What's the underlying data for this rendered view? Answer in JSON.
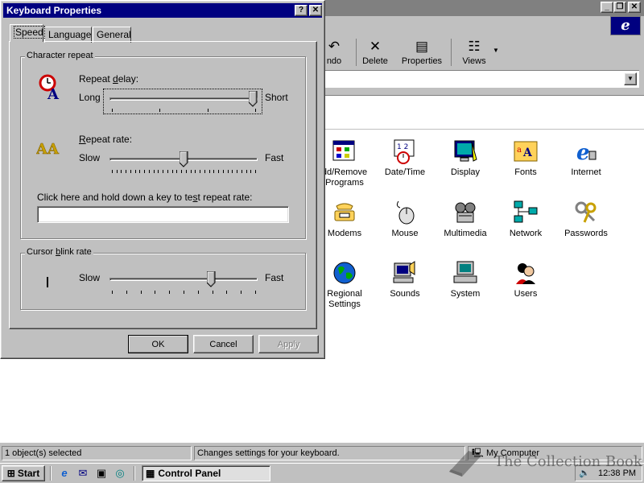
{
  "window": {
    "toolbar": {
      "buttons": [
        {
          "label": "ndo",
          "icon": "undo-icon"
        },
        {
          "label": "Delete",
          "icon": "delete-icon"
        },
        {
          "label": "Properties",
          "icon": "properties-icon"
        },
        {
          "label": "Views",
          "icon": "views-icon"
        }
      ]
    },
    "items": [
      {
        "label": "dd/Remove\nPrograms",
        "icon": "add-remove-programs-icon"
      },
      {
        "label": "Date/Time",
        "icon": "date-time-icon"
      },
      {
        "label": "Display",
        "icon": "display-icon"
      },
      {
        "label": "Fonts",
        "icon": "fonts-icon"
      },
      {
        "label": "Internet",
        "icon": "internet-icon"
      },
      {
        "label": "Modems",
        "icon": "modems-icon"
      },
      {
        "label": "Mouse",
        "icon": "mouse-icon"
      },
      {
        "label": "Multimedia",
        "icon": "multimedia-icon"
      },
      {
        "label": "Network",
        "icon": "network-icon"
      },
      {
        "label": "Passwords",
        "icon": "passwords-icon"
      },
      {
        "label": "Regional\nSettings",
        "icon": "regional-settings-icon"
      },
      {
        "label": "Sounds",
        "icon": "sounds-icon"
      },
      {
        "label": "System",
        "icon": "system-icon"
      },
      {
        "label": "Users",
        "icon": "users-icon"
      }
    ],
    "statusbar": {
      "selection": "1 object(s) selected",
      "description": "Changes settings for your keyboard.",
      "location": "My Computer"
    }
  },
  "dialog": {
    "title": "Keyboard Properties",
    "tabs": [
      "Speed",
      "Language",
      "General"
    ],
    "active_tab": "Speed",
    "character_repeat": {
      "group_label": "Character repeat",
      "repeat_delay": {
        "label": "Repeat delay:",
        "min_label": "Long",
        "max_label": "Short",
        "value": 1.0
      },
      "repeat_rate": {
        "label": "Repeat rate:",
        "min_label": "Slow",
        "max_label": "Fast",
        "value": 0.5
      },
      "test_label": "Click here and hold down a key to test repeat rate:",
      "test_value": ""
    },
    "cursor_blink": {
      "group_label": "Cursor blink rate",
      "min_label": "Slow",
      "max_label": "Fast",
      "value": 0.7
    },
    "buttons": {
      "ok": "OK",
      "cancel": "Cancel",
      "apply": "Apply"
    }
  },
  "taskbar": {
    "start": "Start",
    "task": "Control Panel",
    "clock": "12:38 PM"
  },
  "watermark": "The Collection Book"
}
